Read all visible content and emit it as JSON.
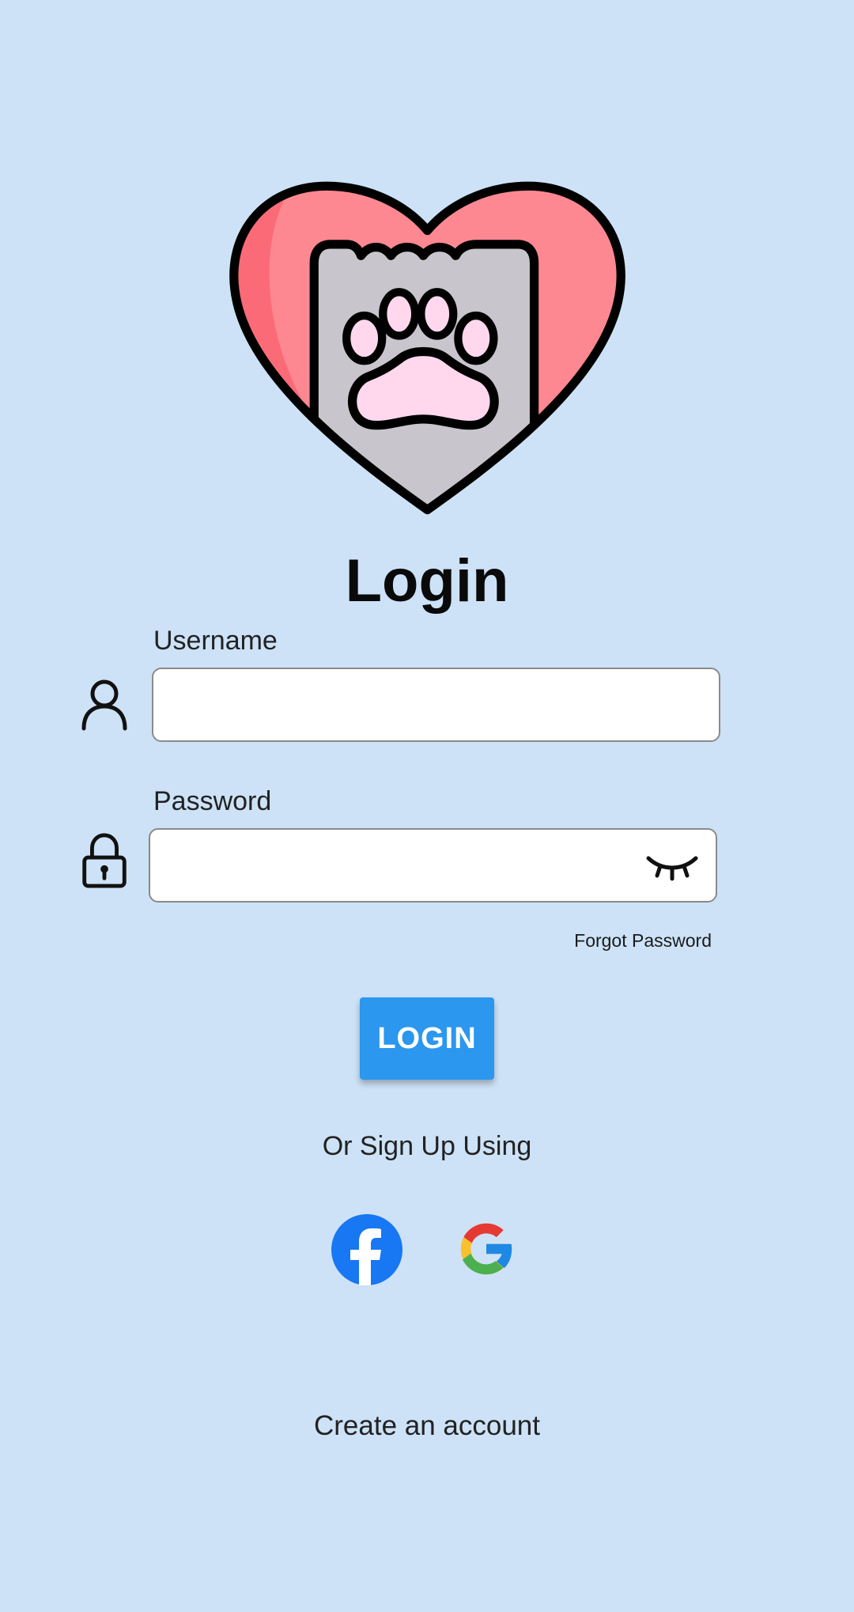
{
  "login": {
    "title": "Login",
    "username_label": "Username",
    "username_value": "",
    "password_label": "Password",
    "password_value": "",
    "forgot_password": "Forgot Password",
    "submit_label": "LOGIN",
    "alt_signup_text": "Or Sign Up Using",
    "create_account": "Create an account"
  },
  "social": [
    "facebook-icon",
    "google-icon"
  ],
  "icons": {
    "logo": "heart-paw-icon",
    "username": "user-icon",
    "password": "lock-icon",
    "visibility": "eye-closed-icon"
  },
  "colors": {
    "background": "#cde2f7",
    "primary_button": "#2b97ee",
    "heart": "#fd8892",
    "paw": "#c9c5cc",
    "paw_pad": "#ffd8ee",
    "facebook": "#1877f2"
  }
}
